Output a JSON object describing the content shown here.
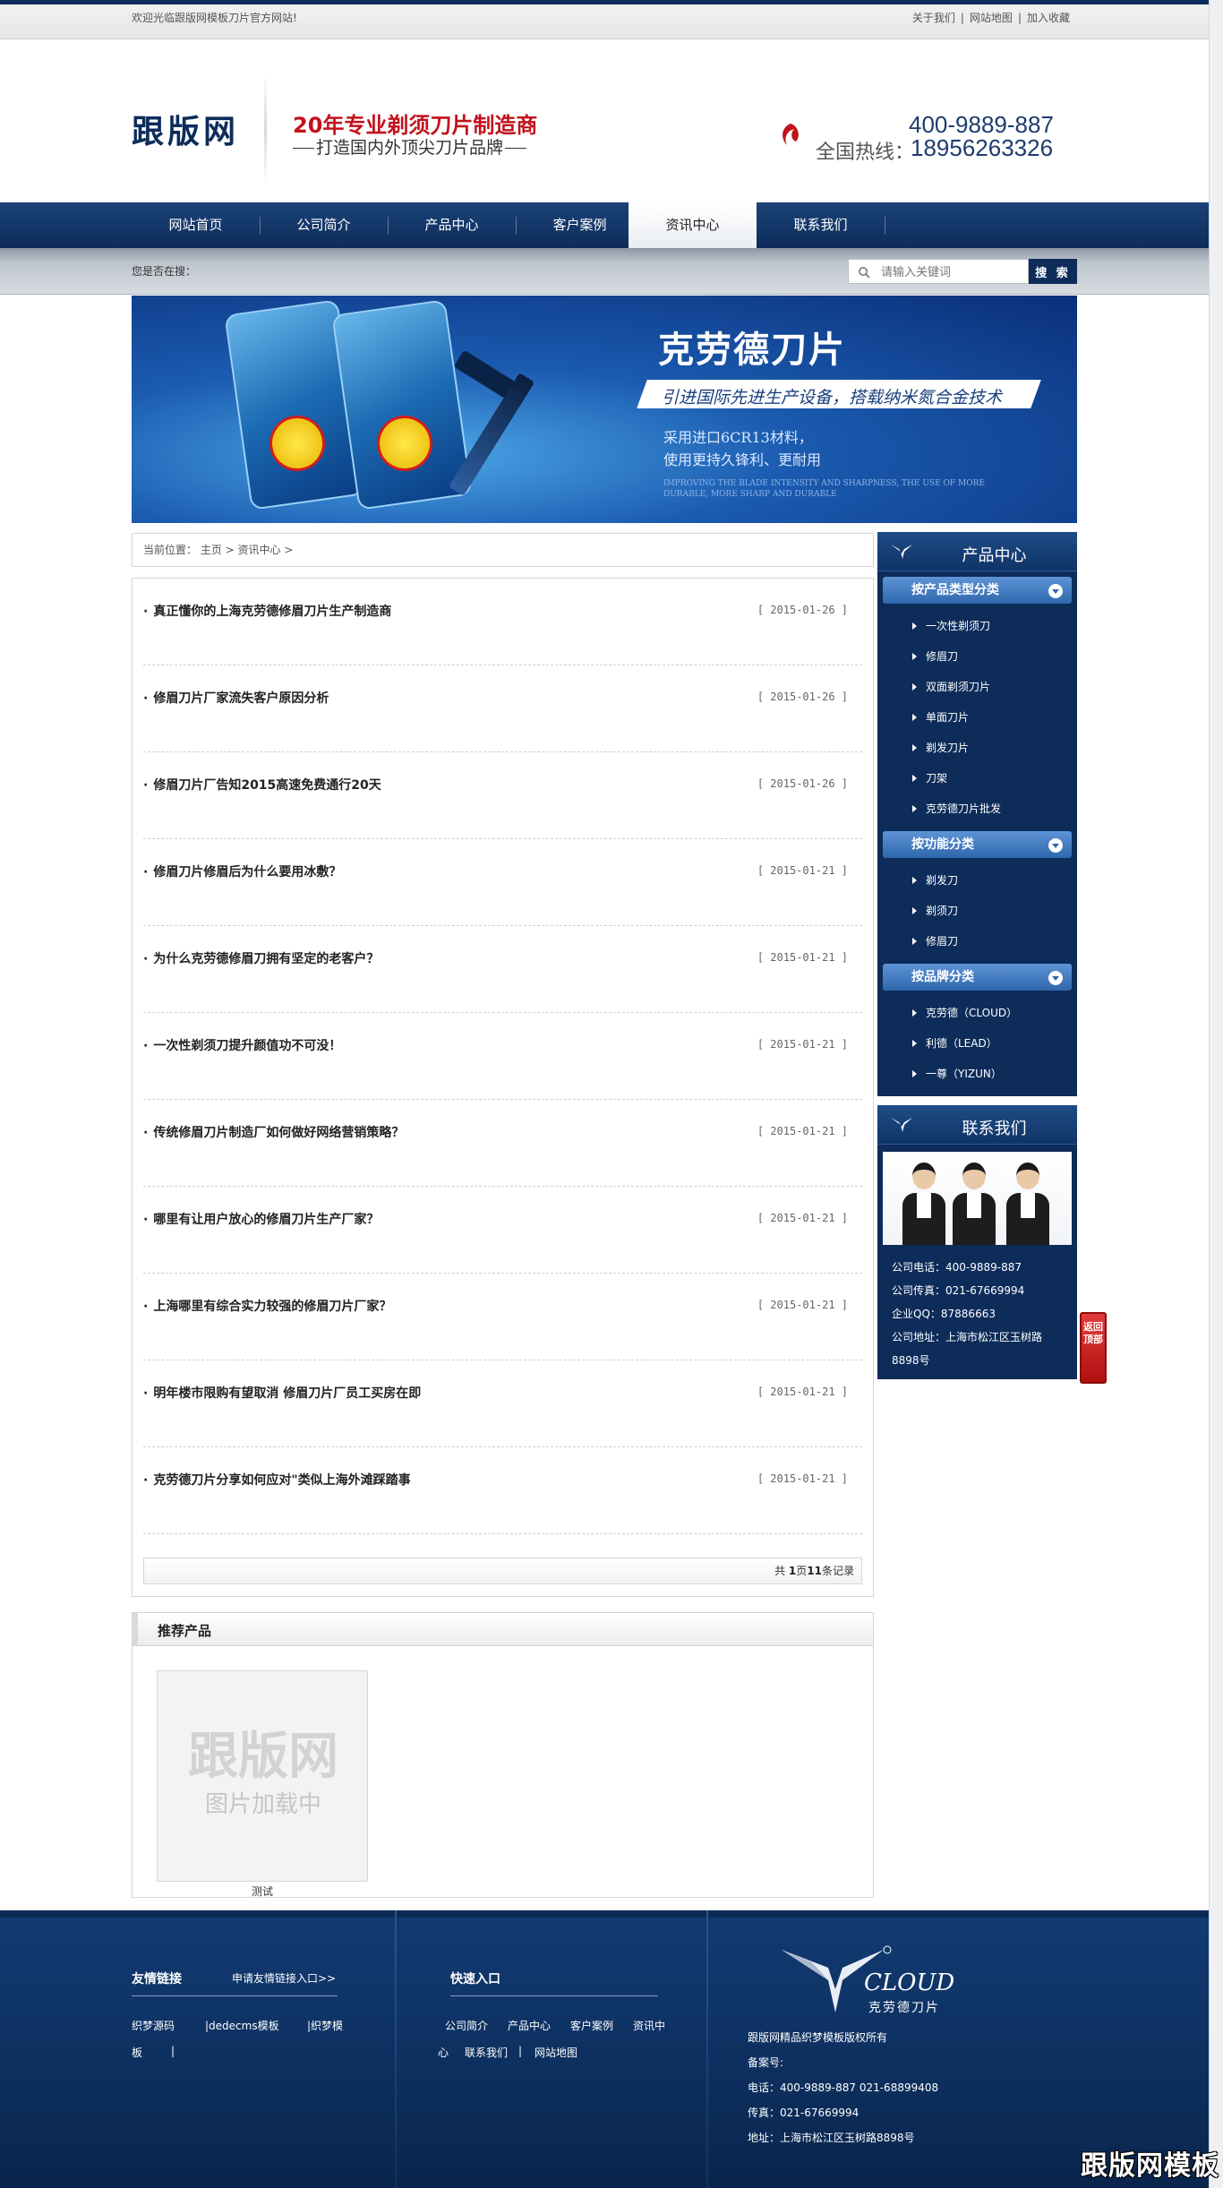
{
  "topbar": {
    "welcome": "欢迎光临跟版网模板刀片官方网站!",
    "links": [
      "关于我们",
      "网站地图",
      "加入收藏"
    ]
  },
  "header": {
    "logo": "跟版网",
    "slogan_main": "20年专业剃须刀片制造商",
    "slogan_sub": "打造国内外顶尖刀片品牌",
    "hotline_number_1": "400-9889-887",
    "hotline_label": "全国热线：",
    "hotline_number_2": "18956263326"
  },
  "nav": {
    "items": [
      "网站首页",
      "公司简介",
      "产品中心",
      "客户案例",
      "资讯中心",
      "联系我们"
    ],
    "active": "资讯中心"
  },
  "search": {
    "location_label": "您是否在搜：",
    "placeholder": "请输入关键词",
    "button_label": "搜 索"
  },
  "banner": {
    "title": "克劳德刀片",
    "subtitle": "引进国际先进生产设备，搭载纳米氮合金技术",
    "line1": "采用进口6CR13材料，",
    "line2": "使用更持久锋利、更耐用",
    "english": "IMPROVING THE BLADE INTENSITY AND SHARPNESS, THE USE OF MORE DURABLE, MORE SHARP AND DURABLE"
  },
  "breadcrumb": "当前位置： 主页 > 资讯中心 >",
  "news": [
    {
      "title": "真正懂你的上海克劳德修眉刀片生产制造商",
      "date": "[ 2015-01-26 ]"
    },
    {
      "title": "修眉刀片厂家流失客户原因分析",
      "date": "[ 2015-01-26 ]"
    },
    {
      "title": "修眉刀片厂告知2015高速免费通行20天",
      "date": "[ 2015-01-26 ]"
    },
    {
      "title": "修眉刀片修眉后为什么要用冰敷？",
      "date": "[ 2015-01-21 ]"
    },
    {
      "title": "为什么克劳德修眉刀拥有坚定的老客户？",
      "date": "[ 2015-01-21 ]"
    },
    {
      "title": "一次性剃须刀提升颜值功不可没！",
      "date": "[ 2015-01-21 ]"
    },
    {
      "title": "传统修眉刀片制造厂如何做好网络营销策略？",
      "date": "[ 2015-01-21 ]"
    },
    {
      "title": "哪里有让用户放心的修眉刀片生产厂家？",
      "date": "[ 2015-01-21 ]"
    },
    {
      "title": "上海哪里有综合实力较强的修眉刀片厂家？",
      "date": "[ 2015-01-21 ]"
    },
    {
      "title": "明年楼市限购有望取消 修眉刀片厂员工买房在即",
      "date": "[ 2015-01-21 ]"
    },
    {
      "title": "克劳德刀片分享如何应对\"类似上海外滩踩踏事",
      "date": "[ 2015-01-21 ]"
    }
  ],
  "pager": {
    "prefix": "共 ",
    "pages": "1",
    "mid": "页",
    "records": "11",
    "suffix": "条记录"
  },
  "recommend": {
    "title": "推荐产品",
    "placeholder_1": "跟版网",
    "placeholder_2": "图片加载中",
    "caption": "测试"
  },
  "sidebar": {
    "product_title": "产品中心",
    "groups": [
      {
        "label": "按产品类型分类",
        "items": [
          "一次性剃须刀",
          "修眉刀",
          "双面剃须刀片",
          "单面刀片",
          "剃发刀片",
          "刀架",
          "克劳德刀片批发"
        ]
      },
      {
        "label": "按功能分类",
        "items": [
          "剃发刀",
          "剃须刀",
          "修眉刀"
        ]
      },
      {
        "label": "按品牌分类",
        "items": [
          "克劳德（CLOUD）",
          "利德（LEAD）",
          "一尊（YIZUN）"
        ]
      }
    ],
    "contact_title": "联系我们",
    "contact_lines": [
      "公司电话：400-9889-887",
      "公司传真：021-67669994",
      "企业QQ：87886663",
      "公司地址：上海市松江区玉树路8898号"
    ]
  },
  "back_to_top": "返回顶部",
  "footer": {
    "links_title": "友情链接",
    "apply_link": "申请友情链接入口>>",
    "friend_links": [
      "织梦源码",
      "|dedecms模板",
      "|织梦模",
      "板",
      "|"
    ],
    "quick_title": "快速入口",
    "quick_links": [
      "公司简介",
      "产品中心",
      "客户案例",
      "资讯中",
      "心",
      "联系我们",
      "|",
      "网站地图"
    ],
    "brand": "CLOUD",
    "brand_cn": "克劳德刀片",
    "copyright": "跟版网精品织梦模板版权所有",
    "icp": "备案号:",
    "phone": "电话：400-9889-887  021-68899408",
    "fax": "传真：021-67669994",
    "address": "地址：上海市松江区玉树路8898号"
  },
  "watermark": "跟版网模板"
}
